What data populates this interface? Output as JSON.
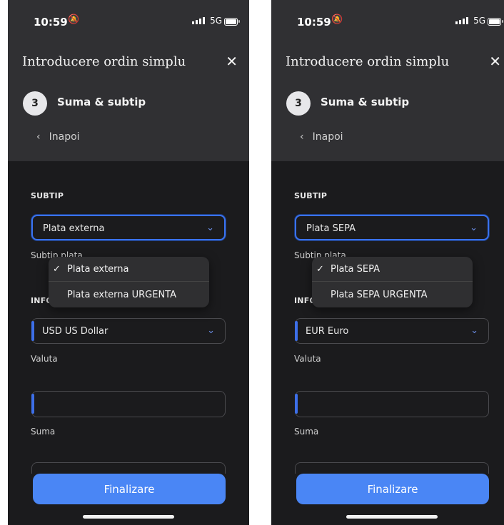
{
  "screens": [
    {
      "status": {
        "time": "10:59",
        "network": "5G"
      },
      "header": {
        "title": "Introducere ordin simplu",
        "step_number": "3",
        "step_label": "Suma & subtip",
        "back_label": "Inapoi"
      },
      "subtip": {
        "section": "SUBTIP",
        "selected": "Plata externa",
        "caption": "Subtip plata"
      },
      "dropdown": {
        "options": [
          {
            "label": "Plata externa",
            "selected": true
          },
          {
            "label": "Plata externa URGENTA",
            "selected": false
          }
        ],
        "check": "✓"
      },
      "info": {
        "section": "INFO"
      },
      "currency": {
        "value": "USD US Dollar",
        "caption": "Valuta"
      },
      "amount": {
        "value": "",
        "caption": "Suma"
      },
      "submit_label": "Finalizare"
    },
    {
      "status": {
        "time": "10:59",
        "network": "5G"
      },
      "header": {
        "title": "Introducere ordin simplu",
        "step_number": "3",
        "step_label": "Suma & subtip",
        "back_label": "Inapoi"
      },
      "subtip": {
        "section": "SUBTIP",
        "selected": "Plata SEPA",
        "caption": "Subtip plata"
      },
      "dropdown": {
        "options": [
          {
            "label": "Plata SEPA",
            "selected": true
          },
          {
            "label": "Plata SEPA URGENTA",
            "selected": false
          }
        ],
        "check": "✓"
      },
      "info": {
        "section": "INFO"
      },
      "currency": {
        "value": "EUR Euro",
        "caption": "Valuta"
      },
      "amount": {
        "value": "",
        "caption": "Suma"
      },
      "submit_label": "Finalizare"
    }
  ],
  "colors": {
    "accent": "#3d6fe8",
    "button": "#4a86f5",
    "background": "#1b1b1d",
    "header": "#303033"
  }
}
